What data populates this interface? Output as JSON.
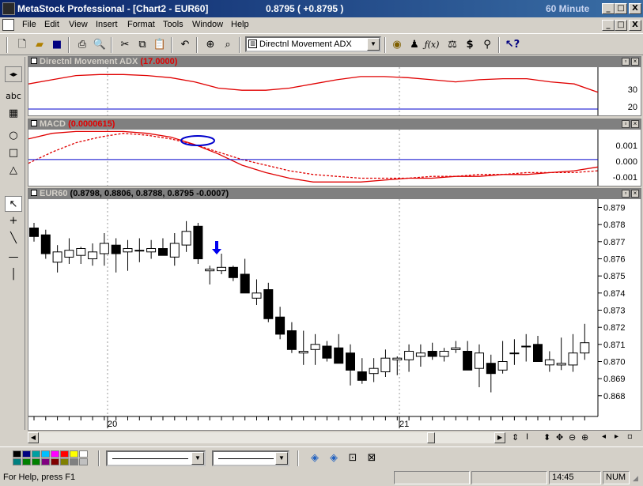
{
  "window": {
    "title": "MetaStock Professional - [Chart2 - EUR60]",
    "price_readout": "0.8795 ( +0.8795 )",
    "interval": "60 Minute",
    "min_label": "_",
    "max_label": "□",
    "close_label": "X"
  },
  "menu": [
    "File",
    "Edit",
    "View",
    "Insert",
    "Format",
    "Tools",
    "Window",
    "Help"
  ],
  "toolbar": {
    "indicator_select": "Directnl Movement ADX"
  },
  "panes": {
    "adx": {
      "name": "Directnl Movement ADX",
      "value": "(17.0000)",
      "ticks": [
        "30",
        "20"
      ]
    },
    "macd": {
      "name": "MACD",
      "value": "(0.0000615)",
      "ticks": [
        "0.001",
        "0.000",
        "-0.001"
      ]
    },
    "price": {
      "name": "EUR60",
      "value": "(0.8798, 0.8806, 0.8788, 0.8795 -0.0007)",
      "ticks": [
        "0.879",
        "0.878",
        "0.877",
        "0.876",
        "0.875",
        "0.874",
        "0.873",
        "0.872",
        "0.871",
        "0.870",
        "0.869",
        "0.868"
      ],
      "date_labels": [
        "20",
        "21"
      ]
    }
  },
  "statusbar": {
    "help": "For Help, press F1",
    "time": "14:45",
    "num": "NUM"
  },
  "chart_data": [
    {
      "type": "line",
      "title": "Directnl Movement ADX (17.0000)",
      "ylim": [
        17,
        40
      ],
      "x": [
        0,
        10,
        20,
        30,
        40,
        50,
        60,
        70,
        80,
        90,
        100,
        110,
        120,
        130,
        140,
        150,
        160,
        170,
        180,
        190,
        200,
        210,
        220,
        230,
        240
      ],
      "series": [
        {
          "values": [
            32,
            34,
            36,
            36.5,
            36.5,
            36,
            35,
            33,
            30,
            29,
            29,
            30,
            32,
            34,
            35.5,
            35.5,
            35,
            34,
            33,
            34,
            34.5,
            34.5,
            33,
            32,
            28
          ]
        }
      ],
      "grid": false
    },
    {
      "type": "line",
      "title": "MACD (0.0000615)",
      "ylim": [
        -0.0014,
        0.0016
      ],
      "x": [
        0,
        10,
        20,
        30,
        40,
        50,
        60,
        70,
        80,
        90,
        100,
        110,
        120,
        130,
        140,
        150,
        160,
        170,
        180,
        190,
        200,
        210,
        220,
        230,
        240
      ],
      "series": [
        {
          "values": [
            0.0011,
            0.0014,
            0.0015,
            0.0015,
            0.0015,
            0.0014,
            0.0012,
            0.0008,
            0.0003,
            -0.0003,
            -0.0007,
            -0.001,
            -0.0012,
            -0.0012,
            -0.0012,
            -0.0011,
            -0.001,
            -0.001,
            -0.0009,
            -0.0009,
            -0.0008,
            -0.0008,
            -0.0007,
            -0.0006,
            -0.0004
          ]
        },
        {
          "values": [
            -0.0002,
            0.0004,
            0.0009,
            0.0012,
            0.0014,
            0.0013,
            0.0011,
            0.0008,
            0.0004,
            0.0,
            -0.0003,
            -0.0006,
            -0.0008,
            -0.0009,
            -0.001,
            -0.001,
            -0.001,
            -0.0009,
            -0.0009,
            -0.0008,
            -0.0008,
            -0.0007,
            -0.0007,
            -0.0007,
            -0.0006
          ]
        }
      ],
      "grid": false
    },
    {
      "type": "candlestick",
      "title": "EUR60 (0.8798, 0.8806, 0.8788, 0.8795 -0.0007)",
      "ylim": [
        0.8673,
        0.8793
      ],
      "ticks": [
        0.879,
        0.878,
        0.877,
        0.876,
        0.875,
        0.874,
        0.873,
        0.872,
        0.871,
        0.87,
        0.869,
        0.868
      ],
      "date_labels": [
        "20",
        "21"
      ],
      "candles": [
        {
          "o": 0.8778,
          "h": 0.8781,
          "l": 0.877,
          "c": 0.8773
        },
        {
          "o": 0.8774,
          "h": 0.8777,
          "l": 0.876,
          "c": 0.8763
        },
        {
          "o": 0.8758,
          "h": 0.8768,
          "l": 0.8752,
          "c": 0.8764
        },
        {
          "o": 0.8761,
          "h": 0.8772,
          "l": 0.8757,
          "c": 0.8765
        },
        {
          "o": 0.8762,
          "h": 0.8767,
          "l": 0.8757,
          "c": 0.8766
        },
        {
          "o": 0.876,
          "h": 0.8769,
          "l": 0.8756,
          "c": 0.8764
        },
        {
          "o": 0.8763,
          "h": 0.8775,
          "l": 0.8756,
          "c": 0.8769
        },
        {
          "o": 0.8768,
          "h": 0.8772,
          "l": 0.8752,
          "c": 0.8763
        },
        {
          "o": 0.8764,
          "h": 0.8771,
          "l": 0.8753,
          "c": 0.8766
        },
        {
          "o": 0.8765,
          "h": 0.8772,
          "l": 0.8758,
          "c": 0.8765
        },
        {
          "o": 0.8764,
          "h": 0.8771,
          "l": 0.876,
          "c": 0.8766
        },
        {
          "o": 0.8766,
          "h": 0.8772,
          "l": 0.8762,
          "c": 0.8762
        },
        {
          "o": 0.8761,
          "h": 0.8775,
          "l": 0.8756,
          "c": 0.8769
        },
        {
          "o": 0.8768,
          "h": 0.8782,
          "l": 0.8764,
          "c": 0.8776
        },
        {
          "o": 0.8779,
          "h": 0.8781,
          "l": 0.8757,
          "c": 0.876
        },
        {
          "o": 0.8753,
          "h": 0.8756,
          "l": 0.8745,
          "c": 0.8754
        },
        {
          "o": 0.8753,
          "h": 0.8763,
          "l": 0.8751,
          "c": 0.8755
        },
        {
          "o": 0.8755,
          "h": 0.8756,
          "l": 0.8747,
          "c": 0.8749
        },
        {
          "o": 0.8751,
          "h": 0.876,
          "l": 0.874,
          "c": 0.874
        },
        {
          "o": 0.8737,
          "h": 0.8748,
          "l": 0.8733,
          "c": 0.874
        },
        {
          "o": 0.8742,
          "h": 0.8746,
          "l": 0.8723,
          "c": 0.8725
        },
        {
          "o": 0.8726,
          "h": 0.8732,
          "l": 0.8713,
          "c": 0.8716
        },
        {
          "o": 0.8718,
          "h": 0.8723,
          "l": 0.8705,
          "c": 0.8707
        },
        {
          "o": 0.8705,
          "h": 0.8718,
          "l": 0.8698,
          "c": 0.8706
        },
        {
          "o": 0.8707,
          "h": 0.8716,
          "l": 0.8698,
          "c": 0.871
        },
        {
          "o": 0.8709,
          "h": 0.8712,
          "l": 0.87,
          "c": 0.8702
        },
        {
          "o": 0.8708,
          "h": 0.8716,
          "l": 0.8701,
          "c": 0.8699
        },
        {
          "o": 0.8705,
          "h": 0.871,
          "l": 0.8686,
          "c": 0.8695
        },
        {
          "o": 0.8694,
          "h": 0.8702,
          "l": 0.8687,
          "c": 0.8689
        },
        {
          "o": 0.8693,
          "h": 0.8702,
          "l": 0.8688,
          "c": 0.8696
        },
        {
          "o": 0.8694,
          "h": 0.8707,
          "l": 0.8691,
          "c": 0.8702
        },
        {
          "o": 0.8701,
          "h": 0.8703,
          "l": 0.8692,
          "c": 0.8702
        },
        {
          "o": 0.8701,
          "h": 0.871,
          "l": 0.8694,
          "c": 0.8706
        },
        {
          "o": 0.8703,
          "h": 0.871,
          "l": 0.8697,
          "c": 0.8705
        },
        {
          "o": 0.8706,
          "h": 0.8711,
          "l": 0.8701,
          "c": 0.8703
        },
        {
          "o": 0.8703,
          "h": 0.8708,
          "l": 0.87,
          "c": 0.8706
        },
        {
          "o": 0.8707,
          "h": 0.8712,
          "l": 0.8705,
          "c": 0.8708
        },
        {
          "o": 0.8706,
          "h": 0.8712,
          "l": 0.8695,
          "c": 0.8695
        },
        {
          "o": 0.8696,
          "h": 0.871,
          "l": 0.8685,
          "c": 0.8705
        },
        {
          "o": 0.8699,
          "h": 0.8704,
          "l": 0.8682,
          "c": 0.8693
        },
        {
          "o": 0.8695,
          "h": 0.8712,
          "l": 0.8693,
          "c": 0.87
        },
        {
          "o": 0.8705,
          "h": 0.8713,
          "l": 0.8698,
          "c": 0.8705
        },
        {
          "o": 0.8709,
          "h": 0.8716,
          "l": 0.87,
          "c": 0.8709
        },
        {
          "o": 0.871,
          "h": 0.8715,
          "l": 0.8703,
          "c": 0.87
        },
        {
          "o": 0.8698,
          "h": 0.8706,
          "l": 0.8694,
          "c": 0.8701
        },
        {
          "o": 0.8698,
          "h": 0.8714,
          "l": 0.8695,
          "c": 0.8699
        },
        {
          "o": 0.8698,
          "h": 0.8716,
          "l": 0.8694,
          "c": 0.8705
        },
        {
          "o": 0.8705,
          "h": 0.8722,
          "l": 0.8701,
          "c": 0.8711
        }
      ],
      "grid": false
    }
  ]
}
